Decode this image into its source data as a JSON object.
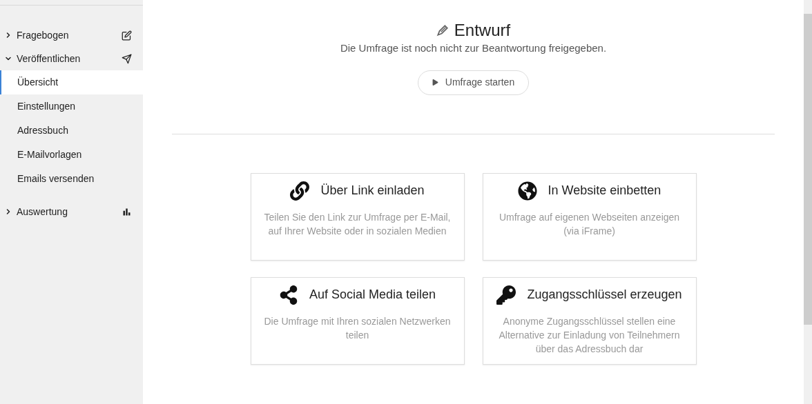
{
  "sidebar": {
    "sections": [
      {
        "label": "Fragebogen",
        "expanded": false
      },
      {
        "label": "Veröffentlichen",
        "expanded": true,
        "children": [
          {
            "label": "Übersicht",
            "selected": true
          },
          {
            "label": "Einstellungen",
            "selected": false
          },
          {
            "label": "Adressbuch",
            "selected": false
          },
          {
            "label": "E-Mailvorlagen",
            "selected": false
          },
          {
            "label": "Emails versenden",
            "selected": false
          }
        ]
      },
      {
        "label": "Auswertung",
        "expanded": false
      }
    ]
  },
  "status": {
    "title": "Entwurf",
    "description": "Die Umfrage ist noch nicht zur Beantwortung freigegeben.",
    "button": "Umfrage starten"
  },
  "cards": [
    {
      "title": "Über Link einladen",
      "description": "Teilen Sie den Link zur Umfrage per E-Mail, auf Ihrer Website oder in sozialen Medien"
    },
    {
      "title": "In Website einbetten",
      "description": "Umfrage auf eigenen Webseiten anzeigen (via iFrame)"
    },
    {
      "title": "Auf Social Media teilen",
      "description": "Die Umfrage mit Ihren sozialen Netzwerken teilen"
    },
    {
      "title": "Zugangsschlüssel erzeugen",
      "description": "Anonyme Zugangsschlüssel stellen eine Alternative zur Einladung von Teilnehmern über das Adressbuch dar"
    }
  ]
}
